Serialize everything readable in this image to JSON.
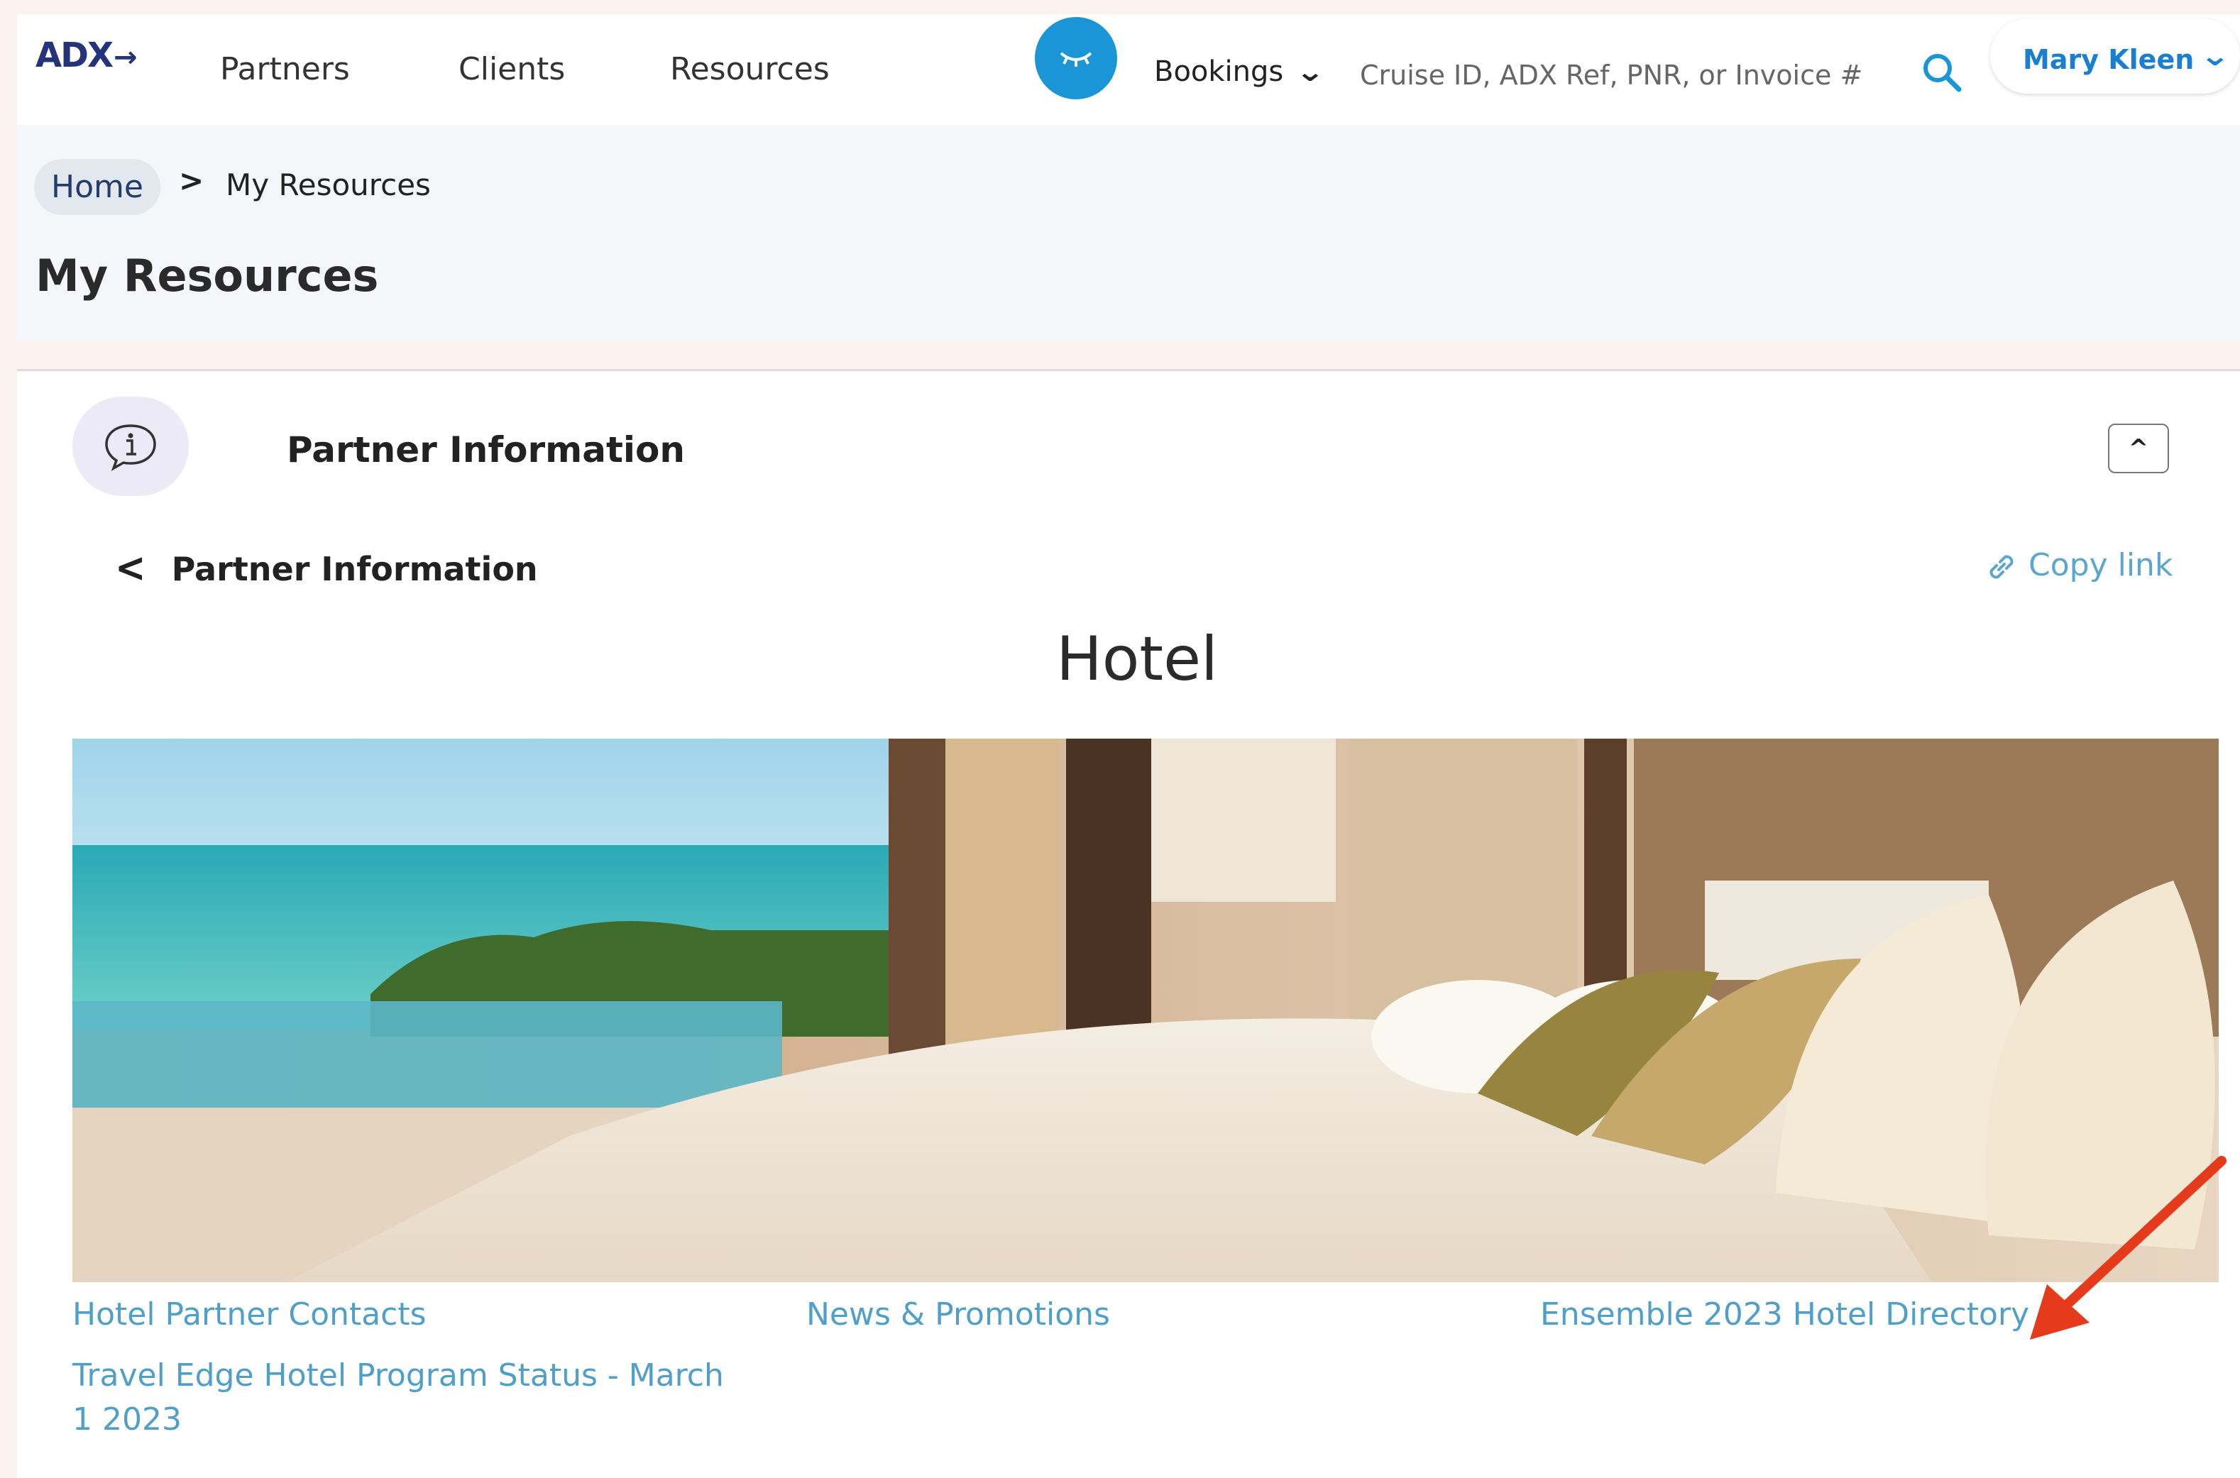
{
  "nav": {
    "logo": "ADX",
    "logo_arrow": "→",
    "links": [
      "Partners",
      "Clients",
      "Resources"
    ],
    "bookings_label": "Bookings",
    "search_placeholder": "Cruise ID, ADX Ref, PNR, or Invoice #",
    "user_name": "Mary Kleen"
  },
  "breadcrumb": {
    "home": "Home",
    "separator": ">",
    "current": "My Resources"
  },
  "page_title": "My Resources",
  "section": {
    "title": "Partner Information",
    "back_label": "Partner Information",
    "copy_link": "Copy link",
    "heading": "Hotel"
  },
  "resource_links": [
    "Hotel Partner Contacts",
    "News & Promotions",
    "Ensemble 2023 Hotel Directory",
    "Travel Edge Hotel Program Status - March",
    "1 2023"
  ],
  "icons": [
    "eye-closed-icon",
    "chevron-down-icon",
    "search-icon",
    "info-chat-icon",
    "chevron-up-icon",
    "chevron-left-icon",
    "link-icon",
    "annotation-arrow"
  ],
  "colors": {
    "accent": "#1a96d7",
    "link": "#4f9fc9",
    "brand": "#25347a",
    "annotation": "#e53b1c"
  }
}
